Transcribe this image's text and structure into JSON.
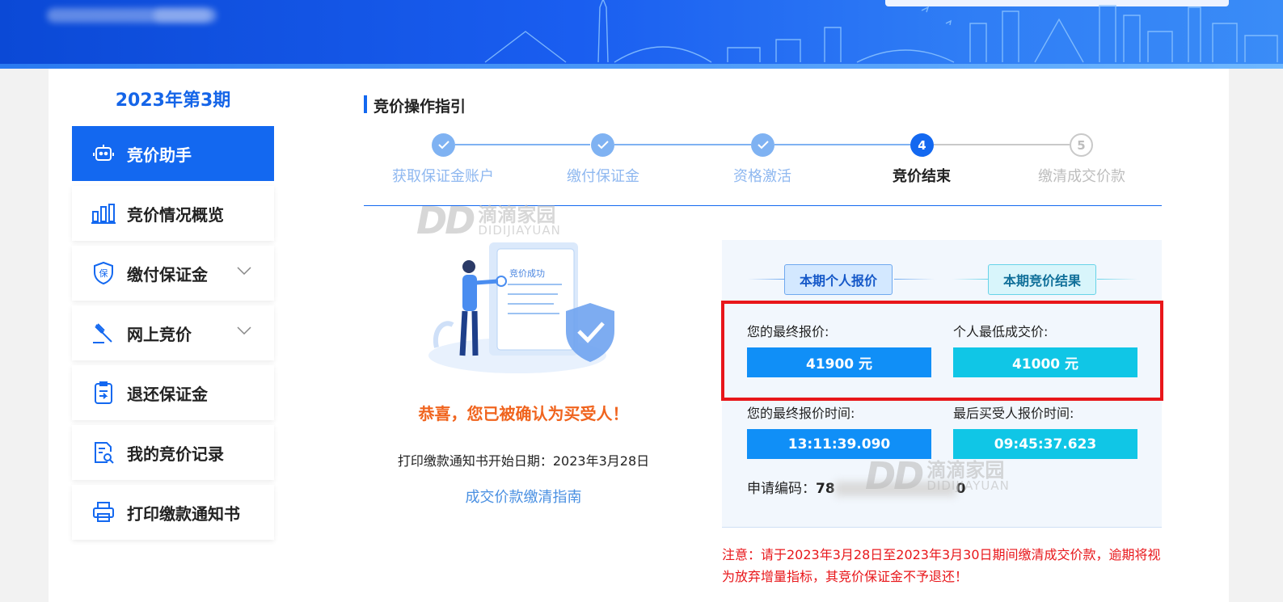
{
  "sidebar": {
    "period": "2023年第3期",
    "items": [
      {
        "label": "竞价助手",
        "icon": "robot-icon",
        "active": true
      },
      {
        "label": "竞价情况概览",
        "icon": "bar-chart-icon"
      },
      {
        "label": "缴付保证金",
        "icon": "shield-bao-icon",
        "expandable": true
      },
      {
        "label": "网上竞价",
        "icon": "gavel-icon",
        "expandable": true
      },
      {
        "label": "退还保证金",
        "icon": "clipboard-return-icon"
      },
      {
        "label": "我的竞价记录",
        "icon": "document-search-icon"
      },
      {
        "label": "打印缴款通知书",
        "icon": "printer-icon"
      }
    ]
  },
  "guide": {
    "title": "竞价操作指引",
    "steps": [
      {
        "label": "获取保证金账户",
        "state": "done"
      },
      {
        "label": "缴付保证金",
        "state": "done"
      },
      {
        "label": "资格激活",
        "state": "done"
      },
      {
        "label": "竞价结束",
        "state": "current",
        "number": "4"
      },
      {
        "label": "缴清成交价款",
        "state": "todo",
        "number": "5"
      }
    ]
  },
  "result": {
    "illustration_text": "竞价成功",
    "congrats": "恭喜，您已被确认为买受人！",
    "print_date": "打印缴款通知书开始日期：2023年3月28日",
    "guide_link": "成交价款缴清指南"
  },
  "panel": {
    "tag_personal": "本期个人报价",
    "tag_result": "本期竞价结果",
    "final_bid_label": "您的最终报价:",
    "final_bid_value": "41900 元",
    "lowest_deal_label": "个人最低成交价:",
    "lowest_deal_value": "41000 元",
    "final_bid_time_label": "您的最终报价时间:",
    "final_bid_time_value": "13:11:39.090",
    "last_buyer_time_label": "最后买受人报价时间:",
    "last_buyer_time_value": "09:45:37.623",
    "app_code_label": "申请编码：",
    "app_code_prefix": "78",
    "app_code_suffix": "0"
  },
  "notice": "注意：请于2023年3月28日至2023年3月30日期间缴清成交价款，逾期将视为放弃增量指标，其竞价保证金不予退还！",
  "watermark": {
    "logo": "DD",
    "cn": "滴滴家园",
    "en": "DIDIJIAYUAN"
  },
  "colors": {
    "primary": "#1368f0",
    "cyan": "#10c6e6",
    "alert": "#e8161a",
    "congrats": "#f0641e"
  }
}
